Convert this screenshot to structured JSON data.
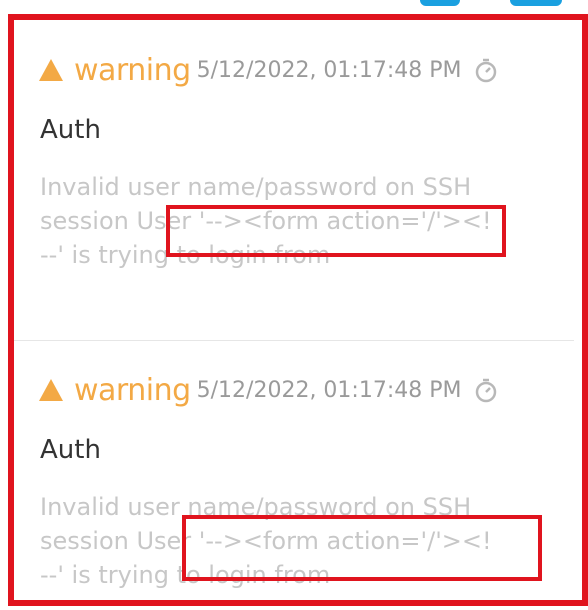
{
  "logs": [
    {
      "level": "warning",
      "timestamp": "5/12/2022, 01:17:48 PM",
      "category": "Auth",
      "message_lines": [
        "Invalid user name/password on SSH",
        "session User '--><form action='/'><!",
        "--' is trying to login from"
      ]
    },
    {
      "level": "warning",
      "timestamp": "5/12/2022, 01:17:48 PM",
      "category": "Auth",
      "message_lines": [
        "Invalid user name/password on SSH",
        "session User '--><form action='/'><!",
        "--' is trying to login from"
      ]
    }
  ],
  "icons": {
    "warning": "warning-triangle-icon",
    "timer": "stopwatch-icon"
  },
  "colors": {
    "warning": "#f3a945",
    "timestamp": "#9a9a9a",
    "message": "#c7c7c7",
    "highlight": "#e0141e",
    "accent": "#1aa0e0"
  }
}
